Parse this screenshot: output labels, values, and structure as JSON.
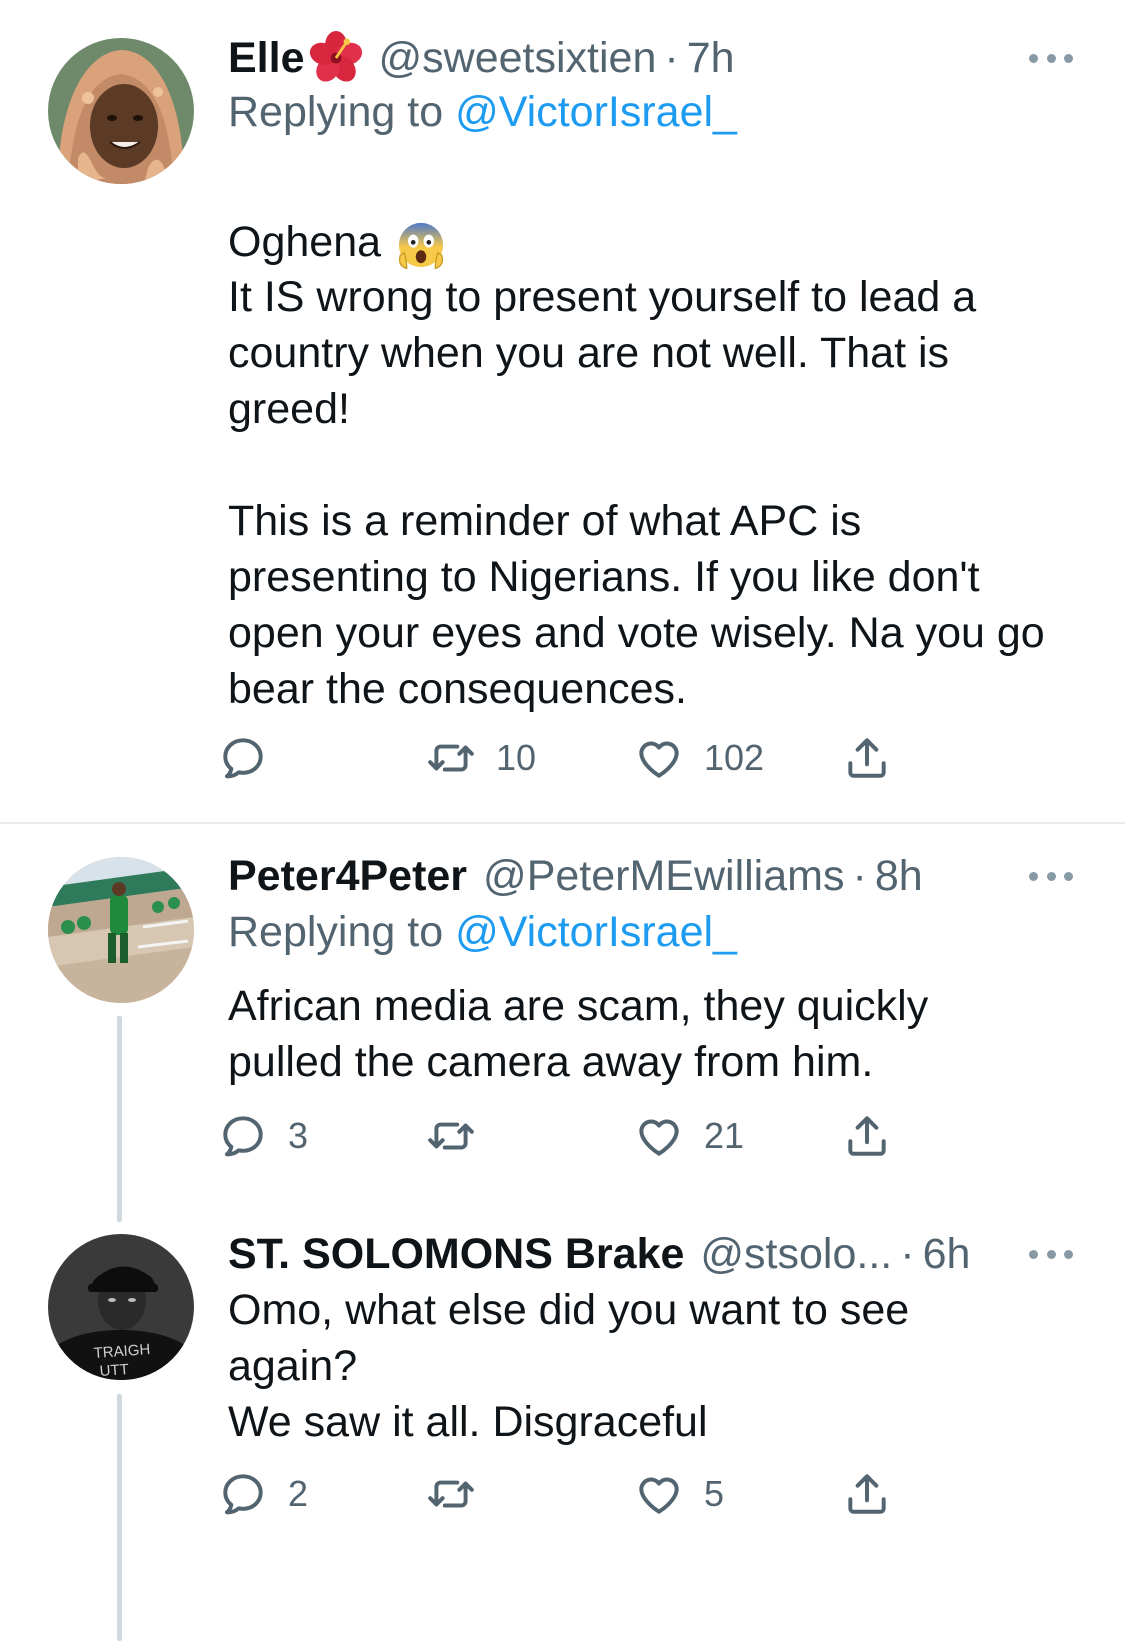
{
  "tweets": [
    {
      "name": "Elle",
      "name_emoji": "hibiscus",
      "handle": "@sweetsixtien",
      "time": "7h",
      "replying_label": "Replying to",
      "replying_to": "@VictorIsrael_",
      "first_line": "Oghena",
      "first_line_emoji": "screaming-in-fear",
      "text": "It IS wrong to present yourself to lead a country when you are not well. That is greed!\n\nThis is a reminder of what APC is presenting to Nigerians. If you like don't open your eyes and vote wisely. Na you go bear the consequences.",
      "replies": "",
      "retweets": "10",
      "likes": "102"
    },
    {
      "name": "Peter4Peter",
      "handle": "@PeterMEwilliams",
      "time": "8h",
      "replying_label": "Replying to",
      "replying_to": "@VictorIsrael_",
      "text": "African media are scam, they quickly pulled the camera away from him.",
      "replies": "3",
      "retweets": "",
      "likes": "21"
    },
    {
      "name": "ST. SOLOMONS Brake",
      "handle": "@stsolo...",
      "time": "6h",
      "text": "Omo, what else did you want to see again?\nWe saw it all. Disgraceful",
      "replies": "2",
      "retweets": "",
      "likes": "5",
      "avatar_shirt_text": "TRAIGH\nUTT"
    }
  ],
  "separator": "·",
  "colors": {
    "text": "#0f1419",
    "secondary": "#536471",
    "link": "#1d9bf0",
    "divider": "#e6ecf0",
    "thread_line": "#cfd9de"
  },
  "icons": [
    "reply-icon",
    "retweet-icon",
    "like-icon",
    "share-icon",
    "more-icon"
  ]
}
